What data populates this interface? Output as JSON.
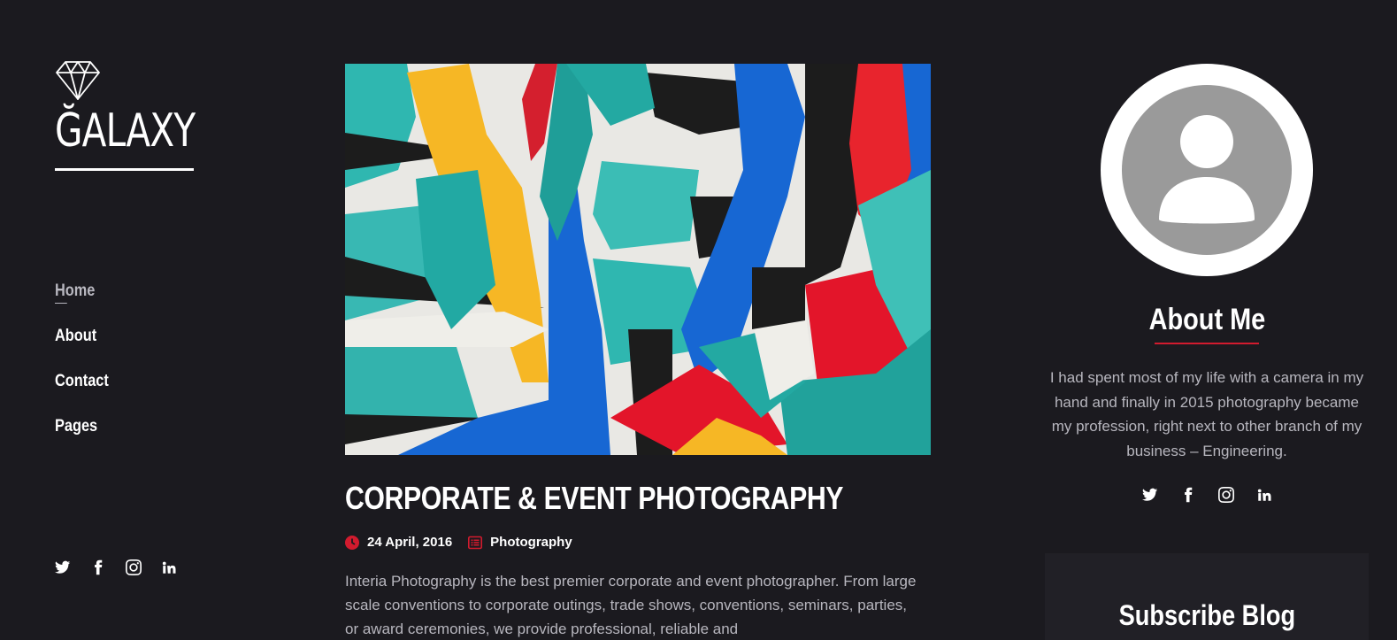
{
  "brand": {
    "name": "ĞALAXY",
    "icon": "diamond-icon"
  },
  "nav": [
    {
      "label": "Home",
      "active": true
    },
    {
      "label": "About",
      "active": false
    },
    {
      "label": "Contact",
      "active": false
    },
    {
      "label": "Pages",
      "active": false
    }
  ],
  "social_icons": [
    "twitter-icon",
    "facebook-icon",
    "instagram-icon",
    "linkedin-icon"
  ],
  "post": {
    "title": "CORPORATE & EVENT PHOTOGRAPHY",
    "date": "24 April, 2016",
    "category": "Photography",
    "excerpt": "Interia Photography is the best premier corporate and event photographer. From large scale conventions to corporate outings, trade shows, conventions, seminars, parties, or award ceremonies, we provide professional, reliable and"
  },
  "about": {
    "title": "About Me",
    "text": "I had spent most of my life with a camera in my hand and finally in 2015 photography became my profession, right next to other branch of my business – Engineering."
  },
  "subscribe": {
    "title": "Subscribe Blog"
  },
  "colors": {
    "background": "#1b1a1f",
    "accent": "#d21b2e",
    "muted_text": "#b7b6be"
  }
}
